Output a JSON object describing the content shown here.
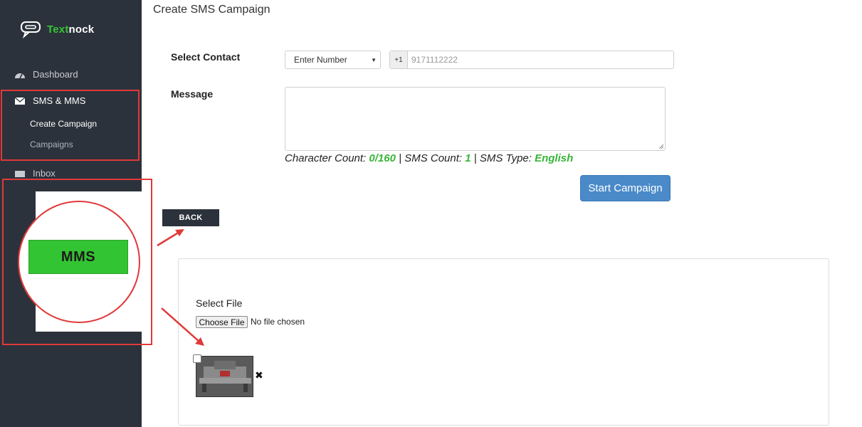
{
  "brand": {
    "name_part1": "Text",
    "name_part2": "nock",
    "accent_color": "#37c437",
    "sidebar_color": "#2c323b"
  },
  "sidebar": {
    "items": [
      {
        "label": "Dashboard",
        "icon": "dashboard-icon"
      },
      {
        "label": "SMS & MMS",
        "icon": "envelope-icon"
      },
      {
        "label": "Inbox",
        "icon": "inbox-icon"
      }
    ],
    "sub_items": [
      {
        "label": "Create Campaign"
      },
      {
        "label": "Campaigns"
      }
    ]
  },
  "callout": {
    "button_label": "MMS",
    "highlight_color": "#e0393a"
  },
  "page": {
    "title": "Create SMS Campaign"
  },
  "form": {
    "contact_label": "Select Contact",
    "contact_select_value": "Enter Number",
    "country_code": "+1",
    "phone_placeholder": "9171112222",
    "message_label": "Message",
    "message_value": "",
    "counts": {
      "char_label": "Character Count:",
      "char_value": "0/160",
      "sms_label": "SMS Count:",
      "sms_value": "1",
      "type_label": "SMS Type:",
      "type_value": "English",
      "separator": "|"
    },
    "start_button": "Start Campaign"
  },
  "back_button": "BACK",
  "upload": {
    "label": "Select File",
    "choose_button": "Choose File",
    "status": "No file chosen",
    "remove_icon": "close-icon"
  }
}
